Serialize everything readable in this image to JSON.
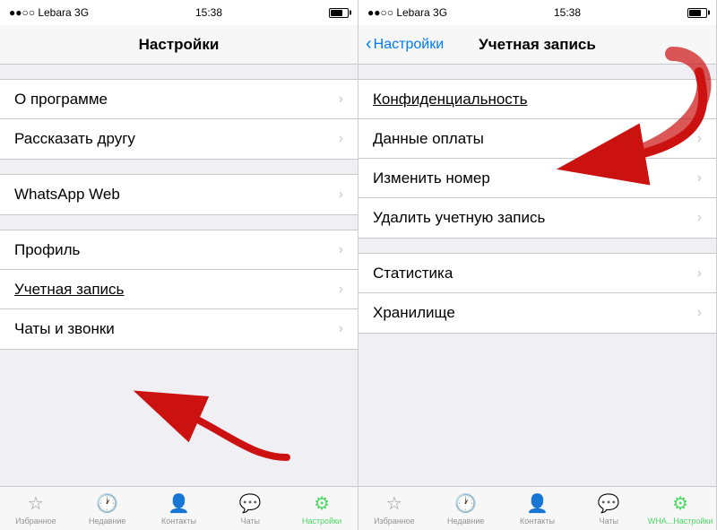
{
  "left_panel": {
    "status": {
      "carrier": "●●○○ Lebara  3G",
      "time": "15:38"
    },
    "nav_title": "Настройки",
    "sections": [
      {
        "items": [
          {
            "label": "О программе",
            "id": "about"
          },
          {
            "label": "Рассказать другу",
            "id": "tell-friend"
          }
        ]
      },
      {
        "items": [
          {
            "label": "WhatsApp Web",
            "id": "whatsapp-web"
          }
        ]
      },
      {
        "items": [
          {
            "label": "Профиль",
            "id": "profile"
          },
          {
            "label": "Учетная запись",
            "id": "account",
            "underlined": true
          },
          {
            "label": "Чаты и звонки",
            "id": "chats-calls"
          }
        ]
      }
    ],
    "tabs": [
      {
        "icon": "☆",
        "label": "Избранное",
        "active": false
      },
      {
        "icon": "🕐",
        "label": "Недавние",
        "active": false
      },
      {
        "icon": "👤",
        "label": "Контакты",
        "active": false
      },
      {
        "icon": "💬",
        "label": "Чаты",
        "active": false
      },
      {
        "icon": "⚙",
        "label": "Настройки",
        "active": true
      }
    ]
  },
  "right_panel": {
    "status": {
      "carrier": "●●○○ Lebara  3G",
      "time": "15:38"
    },
    "nav_back": "Настройки",
    "nav_title": "Учетная запись",
    "sections": [
      {
        "items": [
          {
            "label": "Конфиденциальность",
            "id": "privacy",
            "underlined": true
          },
          {
            "label": "Данные оплаты",
            "id": "payment"
          },
          {
            "label": "Изменить номер",
            "id": "change-number"
          },
          {
            "label": "Удалить учетную запись",
            "id": "delete-account"
          }
        ]
      },
      {
        "items": [
          {
            "label": "Статистика",
            "id": "statistics"
          },
          {
            "label": "Хранилище",
            "id": "storage"
          }
        ]
      }
    ],
    "tabs": [
      {
        "icon": "☆",
        "label": "Избранное",
        "active": false
      },
      {
        "icon": "🕐",
        "label": "Недавние",
        "active": false
      },
      {
        "icon": "👤",
        "label": "Контакты",
        "active": false
      },
      {
        "icon": "💬",
        "label": "Чаты",
        "active": false
      },
      {
        "icon": "⚙",
        "label": "Настройки",
        "active": true
      }
    ]
  }
}
